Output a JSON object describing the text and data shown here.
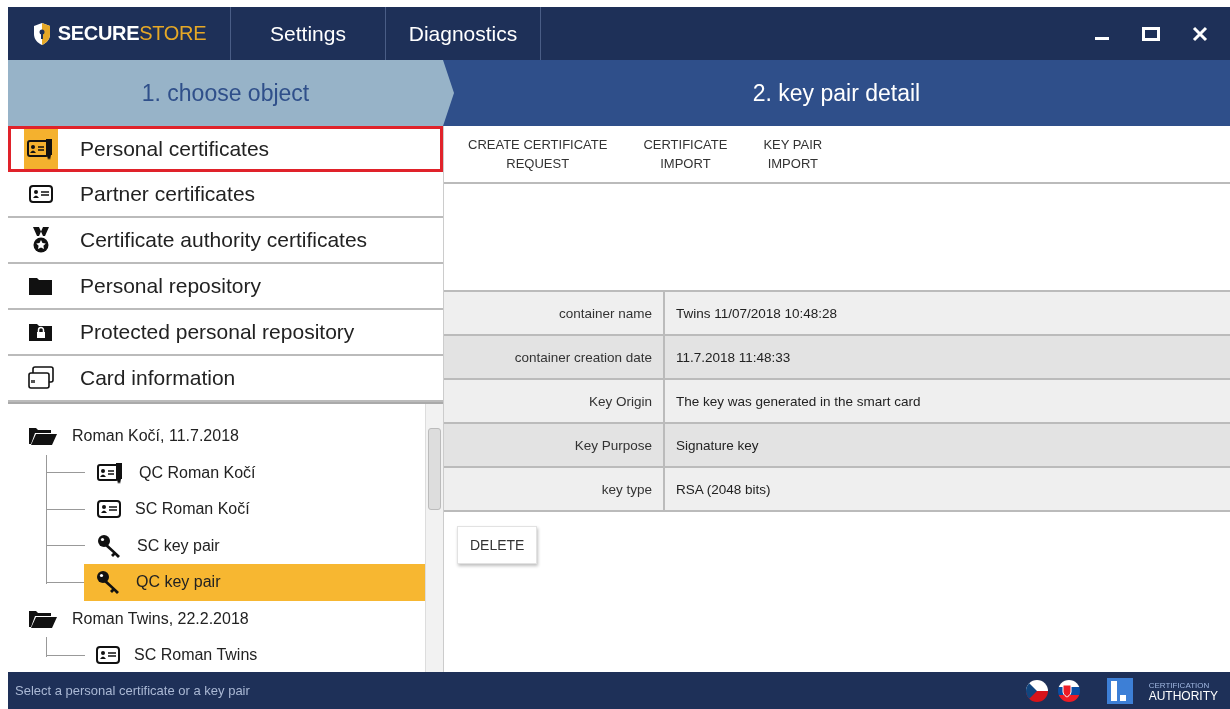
{
  "title_bar": {
    "logo_text": [
      "SECURE",
      "STORE"
    ],
    "tabs": [
      "Settings",
      "Diagnostics"
    ]
  },
  "steps": [
    {
      "label": "1. choose object",
      "selected": false
    },
    {
      "label": "2. key pair detail",
      "selected": true
    }
  ],
  "categories": [
    {
      "label": "Personal certificates",
      "kind": "qualified-cert",
      "selected": true
    },
    {
      "label": "Partner certificates",
      "kind": "cert",
      "selected": false
    },
    {
      "label": "Certificate authority certificates",
      "kind": "medal",
      "selected": false
    },
    {
      "label": "Personal repository",
      "kind": "folder",
      "selected": false
    },
    {
      "label": "Protected personal repository",
      "kind": "locked-folder",
      "selected": false
    },
    {
      "label": "Card information",
      "kind": "cards",
      "selected": false
    }
  ],
  "tree": [
    {
      "label": "Roman Kočí, 11.7.2018",
      "kind": "folder",
      "selected": false,
      "children": [
        {
          "label": "QC Roman Kočí",
          "kind": "qualified-cert",
          "selected": false
        },
        {
          "label": "SC Roman Kočí",
          "kind": "cert",
          "selected": false
        },
        {
          "label": "SC key pair",
          "kind": "key",
          "selected": false
        },
        {
          "label": "QC key pair",
          "kind": "key",
          "selected": true
        }
      ]
    },
    {
      "label": "Roman Twins, 22.2.2018",
      "kind": "folder",
      "selected": false,
      "children": [
        {
          "label": "SC Roman Twins",
          "kind": "cert",
          "selected": false
        }
      ]
    }
  ],
  "toolbar": [
    [
      "CREATE CERTIFICATE",
      "REQUEST"
    ],
    [
      "CERTIFICATE",
      "IMPORT"
    ],
    [
      "KEY PAIR",
      "IMPORT"
    ]
  ],
  "details": [
    {
      "label": "container name",
      "value": "Twins 11/07/2018 10:48:28"
    },
    {
      "label": "container creation date",
      "value": "11.7.2018 11:48:33"
    },
    {
      "label": "Key Origin",
      "value": "The key was generated in the smart card"
    },
    {
      "label": "Key Purpose",
      "value": "Signature key"
    },
    {
      "label": "key type",
      "value": "RSA (2048 bits)"
    }
  ],
  "delete_button": "DELETE",
  "status_bar": {
    "message": "Select a personal certificate or a key pair",
    "logo_text": [
      "CERTIFICATION",
      "AUTHORITY"
    ]
  }
}
